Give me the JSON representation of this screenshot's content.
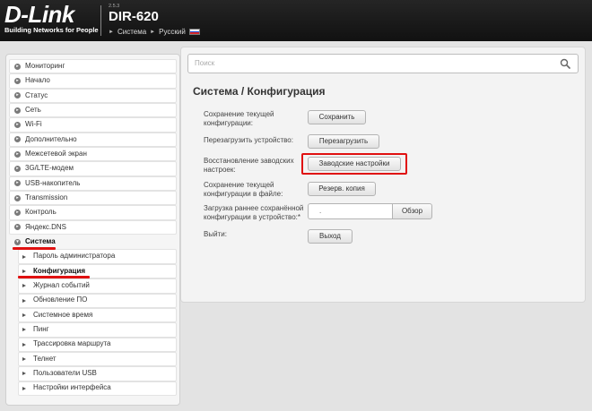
{
  "header": {
    "logo": "D-Link",
    "tagline": "Building Networks for People",
    "firmware_version": "2.5.3",
    "model": "DIR-620",
    "links": [
      "Система",
      "Русский"
    ]
  },
  "sidebar": {
    "items": [
      {
        "label": "Мониторинг",
        "icon": "circle-arrow-icon"
      },
      {
        "label": "Начало",
        "icon": "circle-arrow-icon"
      },
      {
        "label": "Статус",
        "icon": "circle-arrow-icon"
      },
      {
        "label": "Сеть",
        "icon": "circle-arrow-icon"
      },
      {
        "label": "Wi-Fi",
        "icon": "circle-arrow-icon"
      },
      {
        "label": "Дополнительно",
        "icon": "circle-arrow-icon"
      },
      {
        "label": "Межсетевой экран",
        "icon": "circle-arrow-icon"
      },
      {
        "label": "3G/LTE-модем",
        "icon": "circle-arrow-icon"
      },
      {
        "label": "USB-накопитель",
        "icon": "circle-arrow-icon"
      },
      {
        "label": "Transmission",
        "icon": "circle-arrow-icon"
      },
      {
        "label": "Контроль",
        "icon": "circle-arrow-icon"
      },
      {
        "label": "Яндекс.DNS",
        "icon": "circle-arrow-icon"
      },
      {
        "label": "Система",
        "icon": "circle-arrow-icon",
        "active": true
      }
    ],
    "subitems": [
      {
        "label": "Пароль администратора"
      },
      {
        "label": "Конфигурация",
        "active": true
      },
      {
        "label": "Журнал событий"
      },
      {
        "label": "Обновление ПО"
      },
      {
        "label": "Системное время"
      },
      {
        "label": "Пинг"
      },
      {
        "label": "Трассировка маршрута"
      },
      {
        "label": "Телнет"
      },
      {
        "label": "Пользователи USB"
      },
      {
        "label": "Настройки интерфейса"
      }
    ]
  },
  "main": {
    "search_placeholder": "Поиск",
    "title": "Система /  Конфигурация",
    "rows": [
      {
        "label": "Сохранение текущей конфигурации:",
        "button": "Сохранить"
      },
      {
        "label": "Перезагрузить устройство:",
        "button": "Перезагрузить"
      },
      {
        "label": "Восстановление заводских настроек:",
        "button": "Заводские настройки"
      },
      {
        "label": "Сохранение текущей конфигурации в файле:",
        "button": "Резерв. копия"
      },
      {
        "label": "Загрузка раннее сохранённой конфигурации в устройство:*",
        "button": "Обзор"
      },
      {
        "label": "Выйти:",
        "button": "Выход"
      }
    ]
  },
  "colors": {
    "highlight": "#e01010",
    "header_bg": "#1a1a1a"
  }
}
